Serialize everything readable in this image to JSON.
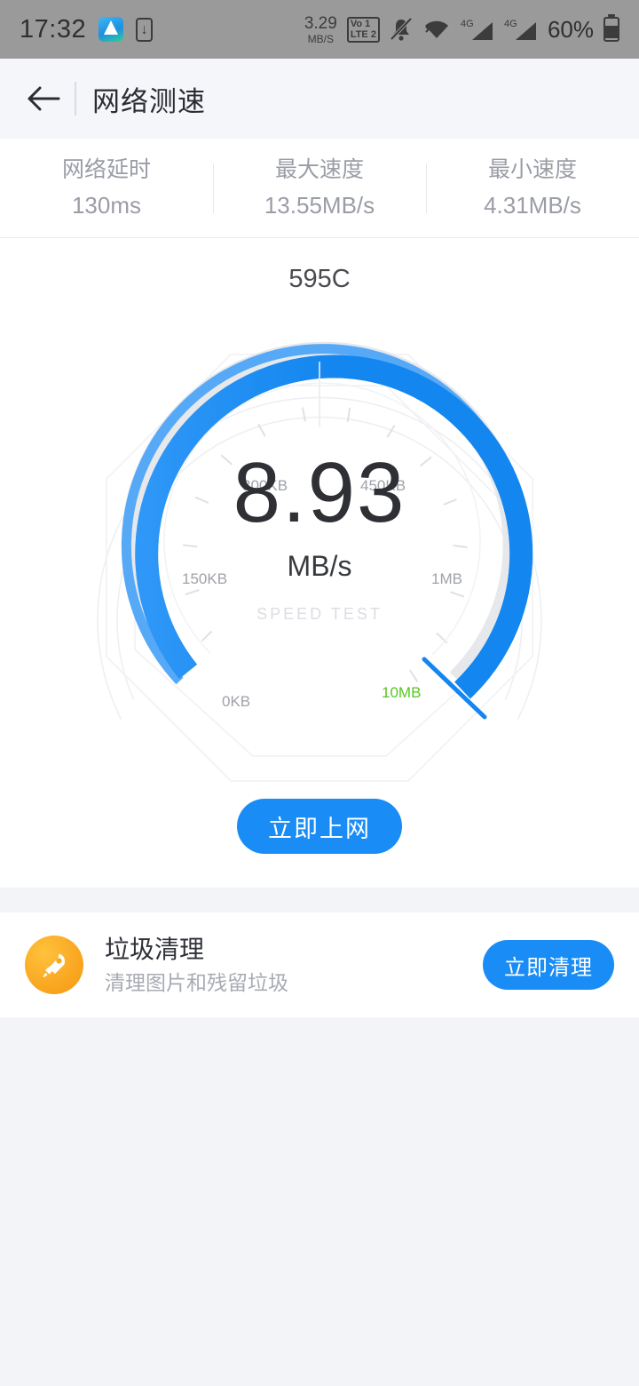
{
  "status_bar": {
    "time": "17:32",
    "app_icon": "mountain-app-icon",
    "download_icon": "download-indicator-icon",
    "net_speed_value": "3.29",
    "net_speed_unit": "MB/S",
    "volte_line1": "Vo 1",
    "volte_line2": "LTE 2",
    "silent_icon": "bell-muted-icon",
    "wifi_icon": "wifi-icon",
    "signal1_label": "4G",
    "signal2_label": "4G",
    "battery_text": "60%",
    "battery_icon": "battery-icon"
  },
  "appbar": {
    "back_icon": "back-arrow-icon",
    "title": "网络测速"
  },
  "stats": [
    {
      "label": "网络延时",
      "value": "130ms"
    },
    {
      "label": "最大速度",
      "value": "13.55MB/s"
    },
    {
      "label": "最小速度",
      "value": "4.31MB/s"
    }
  ],
  "gauge": {
    "ssid": "595C",
    "value": "8.93",
    "unit": "MB/s",
    "caption": "SPEED TEST",
    "accent_color": "#1a8cf5",
    "accent_light_color": "#47a3f7",
    "track_color": "#e3e5ea",
    "highlight_color": "#56c720"
  },
  "chart_data": {
    "type": "gauge",
    "title": "595C",
    "value": 8.93,
    "unit": "MB/s",
    "caption": "SPEED TEST",
    "scale_labels": [
      "0KB",
      "150KB",
      "300KB",
      "450KB",
      "1MB",
      "10MB"
    ],
    "scale_values": [
      0,
      150,
      300,
      450,
      1024,
      10240
    ],
    "highlight_label": "10MB",
    "progress_fraction": 0.97,
    "arc_start_deg": 215,
    "arc_sweep_deg": 290,
    "latency_ms": 130,
    "max_speed_mbps": 13.55,
    "min_speed_mbps": 4.31
  },
  "cta": {
    "label": "立即上网"
  },
  "promo": {
    "icon": "rocket-icon",
    "title": "垃圾清理",
    "subtitle": "清理图片和残留垃圾",
    "button_label": "立即清理"
  }
}
